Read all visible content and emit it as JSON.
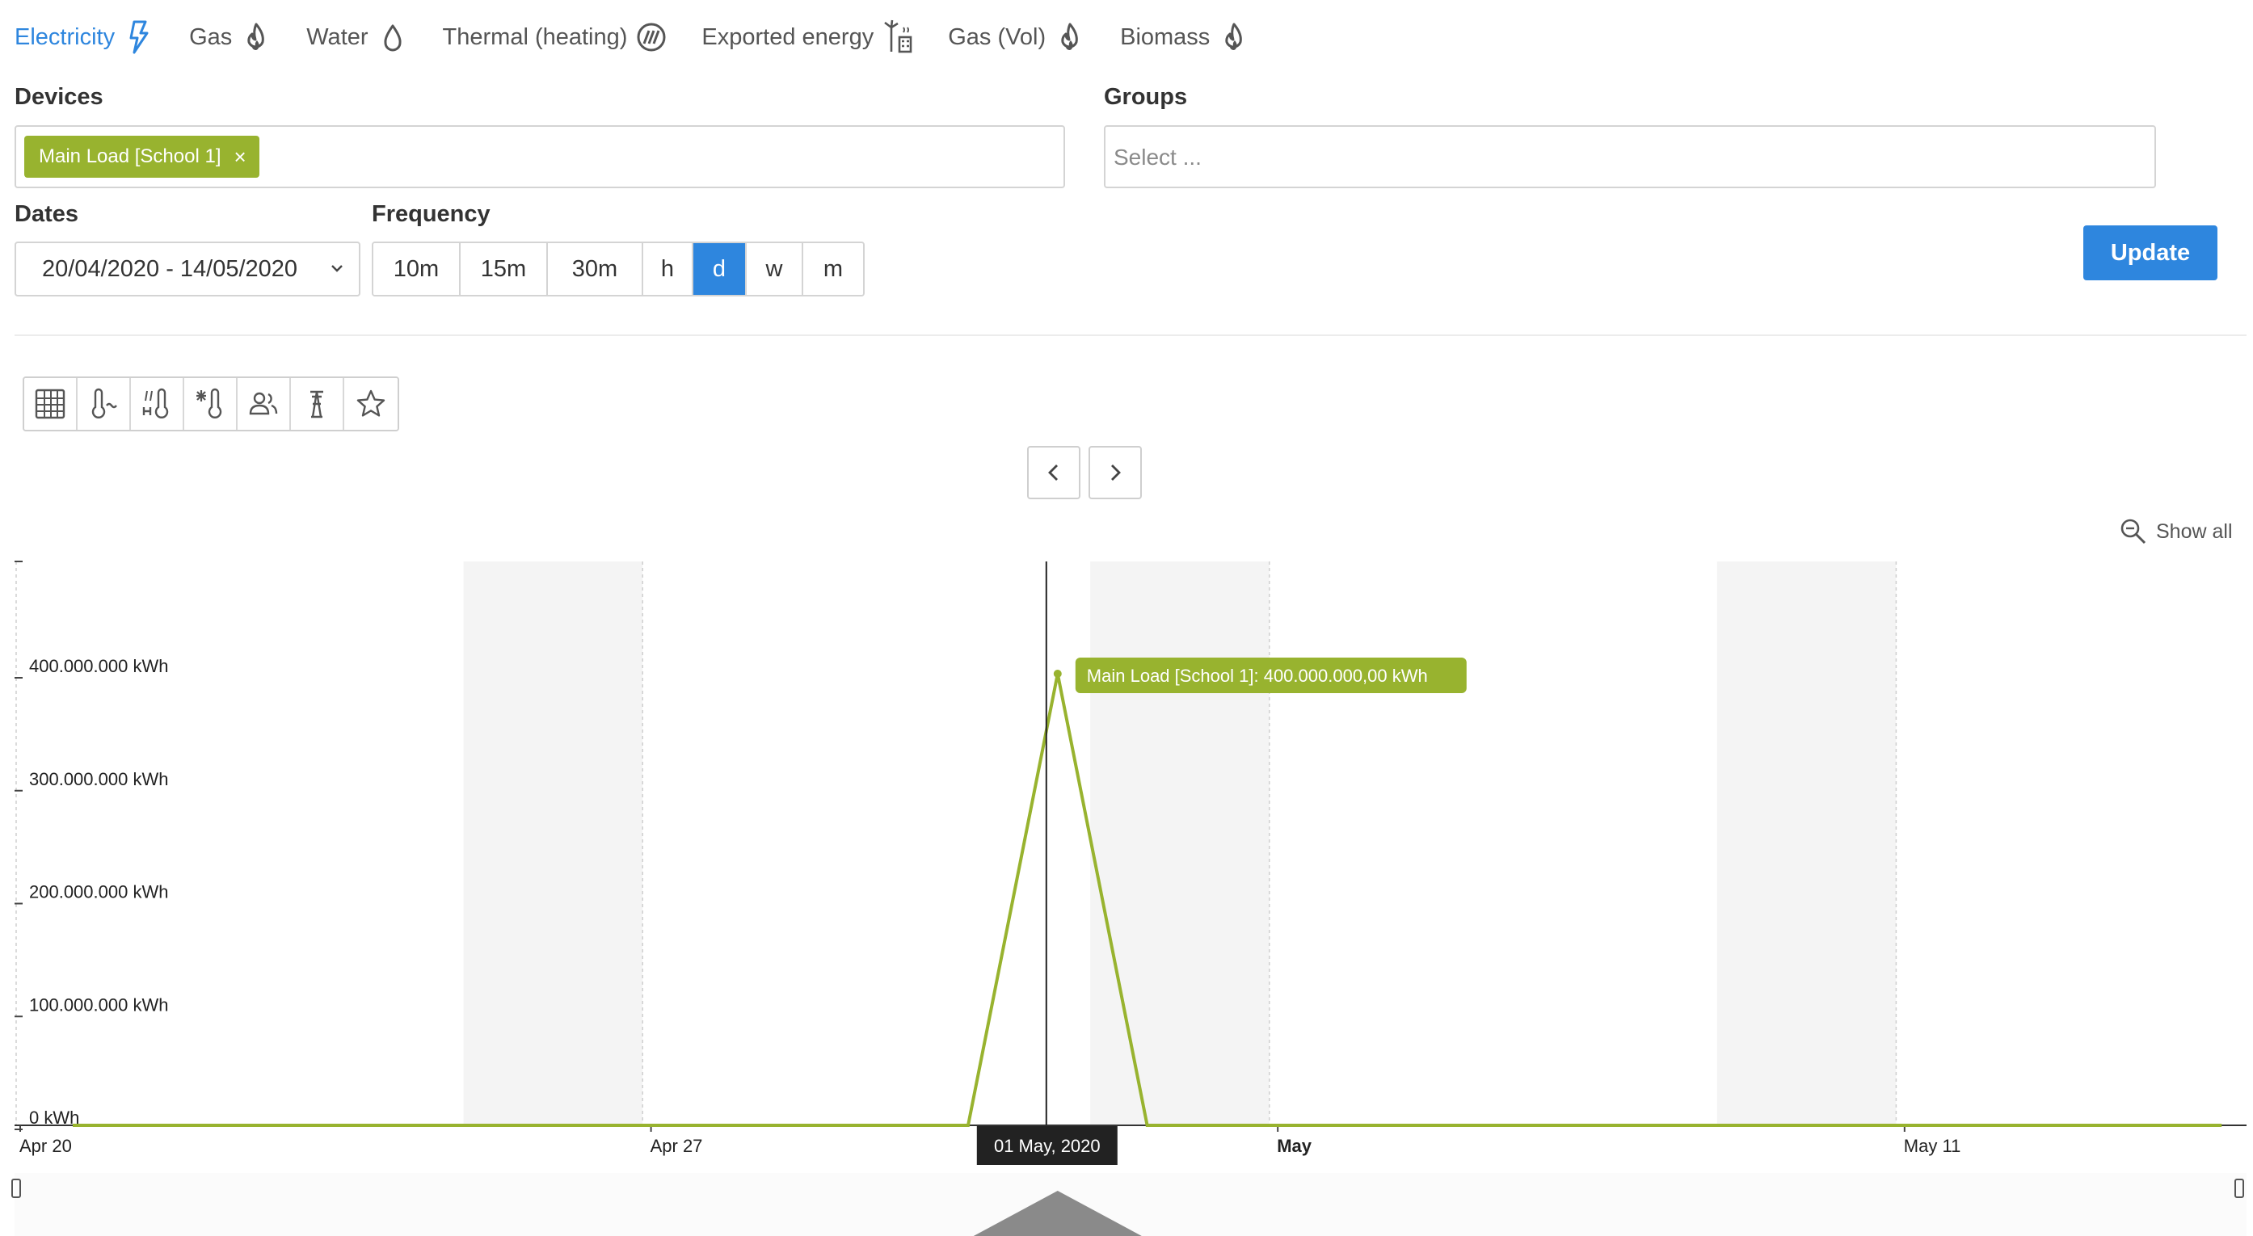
{
  "tabs": [
    {
      "label": "Electricity",
      "icon": "lightning-icon",
      "active": true
    },
    {
      "label": "Gas",
      "icon": "flame-icon",
      "active": false
    },
    {
      "label": "Water",
      "icon": "water-drop-icon",
      "active": false
    },
    {
      "label": "Thermal (heating)",
      "icon": "heating-icon",
      "active": false
    },
    {
      "label": "Exported energy",
      "icon": "wind-turbine-icon",
      "active": false
    },
    {
      "label": "Gas (Vol)",
      "icon": "flame-icon",
      "active": false
    },
    {
      "label": "Biomass",
      "icon": "flame-icon",
      "active": false
    }
  ],
  "form": {
    "devices_label": "Devices",
    "groups_label": "Groups",
    "dates_label": "Dates",
    "frequency_label": "Frequency",
    "device_chip": "Main Load [School 1]",
    "chip_remove": "×",
    "groups_placeholder": "Select ...",
    "date_range": "20/04/2020 - 14/05/2020",
    "frequency_options": [
      "10m",
      "15m",
      "30m",
      "h",
      "d",
      "w",
      "m"
    ],
    "frequency_selected": "d",
    "update_label": "Update"
  },
  "toolbar": {
    "icons": [
      "table-icon",
      "temperature-icon",
      "degree-days-icon",
      "cooling-icon",
      "occupancy-icon",
      "pylon-icon",
      "favorite-star-icon"
    ]
  },
  "show_all_label": "Show all",
  "colors": {
    "accent": "#2e86de",
    "series": "#98b32f",
    "weekend_band": "#f4f4f4"
  },
  "chart_data": {
    "type": "line",
    "series": [
      {
        "name": "Main Load [School 1]",
        "x": [
          "2020-04-20",
          "2020-04-21",
          "2020-04-22",
          "2020-04-23",
          "2020-04-24",
          "2020-04-25",
          "2020-04-26",
          "2020-04-27",
          "2020-04-28",
          "2020-04-29",
          "2020-04-30",
          "2020-05-01",
          "2020-05-02",
          "2020-05-03",
          "2020-05-04",
          "2020-05-05",
          "2020-05-06",
          "2020-05-07",
          "2020-05-08",
          "2020-05-09",
          "2020-05-10",
          "2020-05-11",
          "2020-05-12",
          "2020-05-13",
          "2020-05-14"
        ],
        "values": [
          0,
          0,
          0,
          0,
          0,
          0,
          0,
          0,
          0,
          0,
          0,
          400000000,
          0,
          0,
          0,
          0,
          0,
          0,
          0,
          0,
          0,
          0,
          0,
          0,
          0
        ]
      }
    ],
    "y_ticks": [
      "0 kWh",
      "100.000.000 kWh",
      "200.000.000 kWh",
      "300.000.000 kWh",
      "400.000.000 kWh"
    ],
    "y_tick_values": [
      0,
      100000000,
      200000000,
      300000000,
      400000000
    ],
    "ylim": [
      0,
      500000000
    ],
    "x_ticks": [
      {
        "date": "2020-04-20",
        "label": "Apr 20",
        "bold": false
      },
      {
        "date": "2020-04-27",
        "label": "Apr 27",
        "bold": false
      },
      {
        "date": "2020-05-04",
        "label": "May",
        "bold": true
      },
      {
        "date": "2020-05-11",
        "label": "May 11",
        "bold": false
      }
    ],
    "weekend_bands": [
      [
        "2020-04-25",
        "2020-04-27"
      ],
      [
        "2020-05-02",
        "2020-05-04"
      ],
      [
        "2020-05-09",
        "2020-05-11"
      ]
    ],
    "crosshair_label": "01 May, 2020",
    "tooltip": "Main Load [School 1]: 400.000.000,00 kWh"
  }
}
